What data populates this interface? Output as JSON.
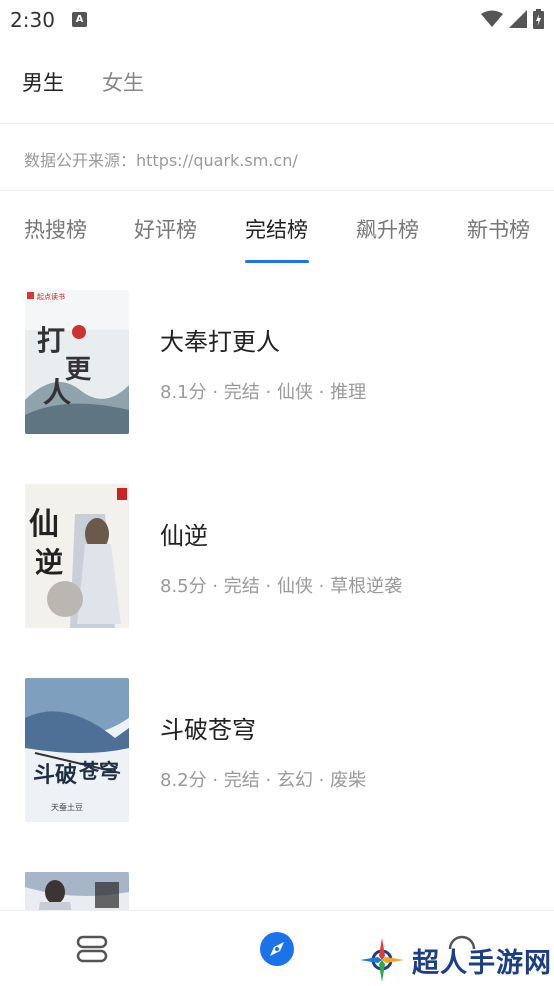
{
  "status_bar": {
    "time": "2:30",
    "notification_badge": "A"
  },
  "gender_tabs": [
    {
      "label": "男生",
      "active": true
    },
    {
      "label": "女生",
      "active": false
    }
  ],
  "source_text": "数据公开来源：https://quark.sm.cn/",
  "rank_tabs": [
    {
      "label": "热搜榜",
      "active": false
    },
    {
      "label": "好评榜",
      "active": false
    },
    {
      "label": "完结榜",
      "active": true
    },
    {
      "label": "飙升榜",
      "active": false
    },
    {
      "label": "新书榜",
      "active": false
    }
  ],
  "books": [
    {
      "title": "大奉打更人",
      "meta": "8.1分 · 完结 · 仙侠 · 推理",
      "cover_label": "起点读书",
      "cover_title": "打更人",
      "cover_author": "卖报小郎君"
    },
    {
      "title": "仙逆",
      "meta": "8.5分 · 完结 · 仙侠 · 草根逆袭",
      "cover_label": "",
      "cover_title": "仙逆",
      "cover_author": ""
    },
    {
      "title": "斗破苍穹",
      "meta": "8.2分 · 完结 · 玄幻 · 废柴",
      "cover_label": "",
      "cover_title": "斗破苍穹",
      "cover_author": "天蚕土豆"
    },
    {
      "title": "",
      "meta": "",
      "cover_label": "",
      "cover_title": "",
      "cover_author": ""
    }
  ],
  "bottom_nav": [
    {
      "icon": "bookshelf-icon",
      "active": false
    },
    {
      "icon": "compass-icon",
      "active": true
    },
    {
      "icon": "profile-icon",
      "active": false
    }
  ],
  "watermark": {
    "text": "超人手游网"
  },
  "colors": {
    "accent": "#1a73e8",
    "watermark_blue": "#1b3f87"
  }
}
